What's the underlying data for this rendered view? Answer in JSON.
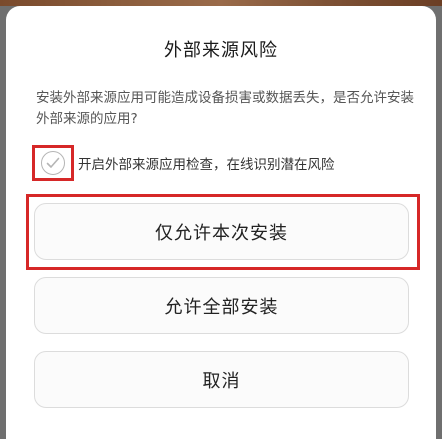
{
  "dialog": {
    "title": "外部来源风险",
    "message": "安装外部来源应用可能造成设备损害或数据丢失，是否允许安装外部来源的应用?",
    "checkbox": {
      "label": "开启外部来源应用检查，在线识别潜在风险",
      "checked": false,
      "icon": "check-circle-icon"
    },
    "buttons": {
      "allow_once": "仅允许本次安装",
      "allow_all": "允许全部安装",
      "cancel": "取消"
    }
  },
  "colors": {
    "highlight_annotation": "#d62828",
    "overlay": "#6f6f6f"
  }
}
